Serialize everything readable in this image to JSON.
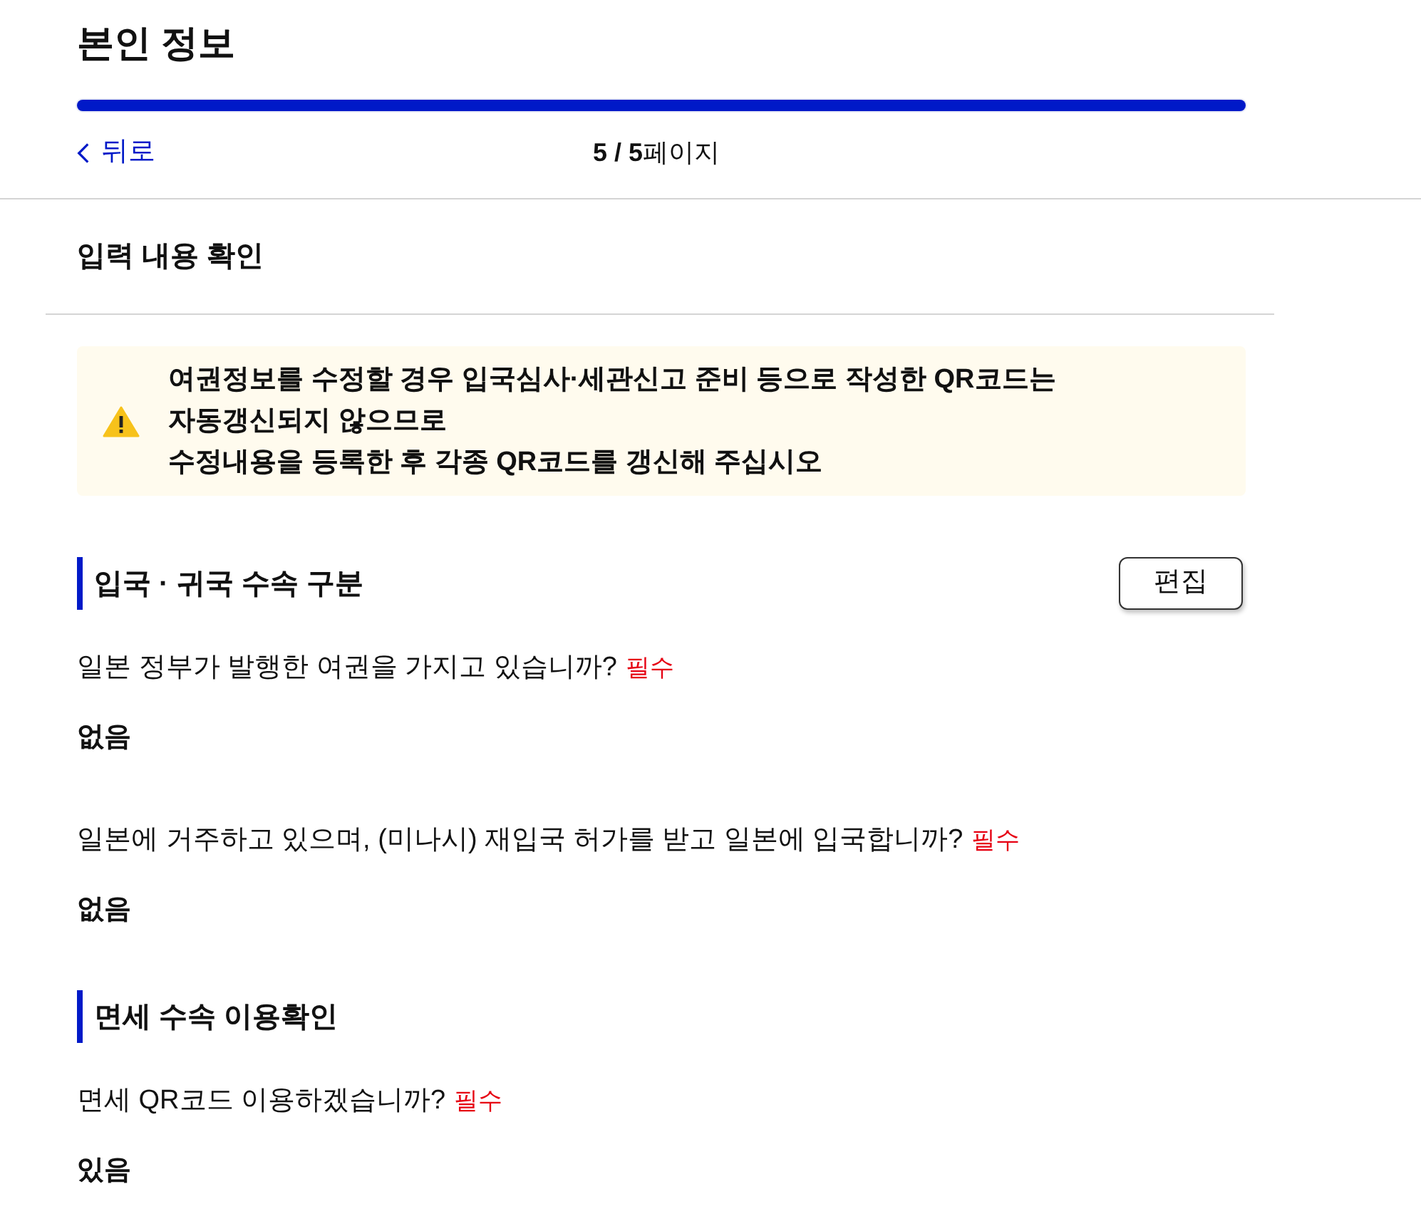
{
  "header": {
    "title": "본인 정보",
    "progress": {
      "level": 1
    },
    "back_link": "뒤로",
    "page_indicator": "**5 / 5**페이지"
  },
  "section_title": "입력 내용 확인",
  "notice": {
    "lines": [
      "여권정보를 수정할 경우 입국심사·세관신고 준비 등으로 작성한 QR코드는",
      "자동갱신되지 않으므로",
      "수정내용을 등록한 후 각종 QR코드를 갱신해 주십시오"
    ]
  },
  "groups": [
    {
      "heading": "입국 · 귀국 수속 구분",
      "edit_button": "편집",
      "items": [
        {
          "question": "일본 정부가 발행한 여권을 가지고 있습니까?",
          "required_label": "필수",
          "answer": "없음"
        },
        {
          "question": "일본에 거주하고 있으며, (미나시) 재입국 허가를 받고 일본에 입국합니까?",
          "required_label": "필수",
          "answer": "없음"
        }
      ]
    },
    {
      "heading": "면세 수속 이용확인",
      "items": [
        {
          "question": "면세 QR코드 이용하겠습니까?",
          "required_label": "필수",
          "answer": "있음"
        }
      ]
    }
  ]
}
